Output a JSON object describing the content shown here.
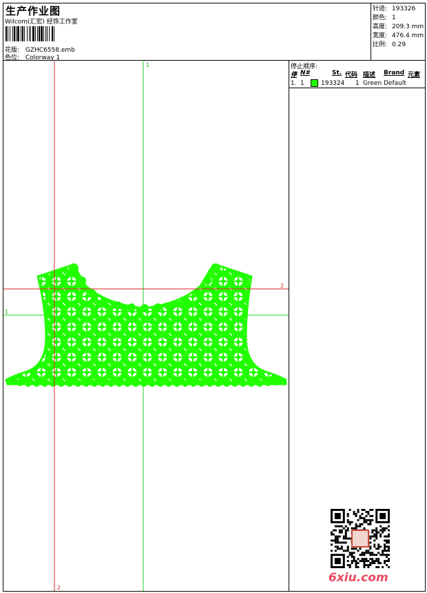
{
  "header": {
    "title": "生产作业图",
    "company": "Wilcom(汇宏) 经饰工作室",
    "design_label": "花版:",
    "design_value": "GZHC6558.emb",
    "colorway_label": "色位:",
    "colorway_value": "Colorway 1"
  },
  "stats": [
    {
      "label": "针迹:",
      "value": "193326"
    },
    {
      "label": "颜色:",
      "value": "1"
    },
    {
      "label": "高度:",
      "value": "209.3 mm"
    },
    {
      "label": "宽度:",
      "value": "476.4 mm"
    },
    {
      "label": "比例:",
      "value": "0.29"
    }
  ],
  "canvas": {
    "guide_labels": {
      "green_top": "1",
      "green_left": "1",
      "red_right": "2",
      "red_bottom": "2"
    },
    "guide_colors": {
      "green": "#22cc22",
      "red": "#dd2222"
    },
    "fill_color": "#22ff00"
  },
  "stop_sequence": {
    "title": "停止顺序:",
    "columns": {
      "stop": "停",
      "n": "N#",
      "st": "St.",
      "code": "代码",
      "desc": "描述",
      "brand": "Brand",
      "element": "元素"
    },
    "rows": [
      {
        "stop": "1.",
        "n": "1",
        "st": "193324",
        "code": "1",
        "desc": "Green",
        "brand": "Default",
        "swatch": "#22ff00"
      }
    ]
  },
  "watermark": {
    "text": "6xiu.com",
    "stamp": "以图会友"
  }
}
